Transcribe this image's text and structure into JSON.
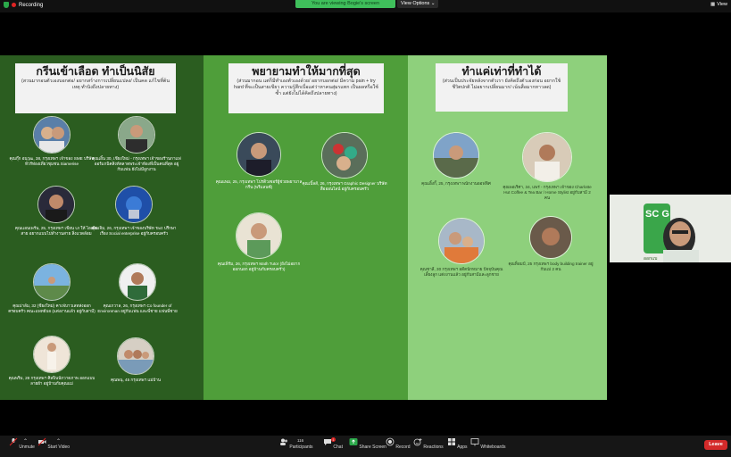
{
  "topbar": {
    "recording_label": "Recording",
    "viewing_banner": "You are viewing Bogie's screen",
    "view_options_label": "View Options",
    "view_label": "View"
  },
  "slide": {
    "columns": [
      {
        "title": "กรีนเข้าเลือด ทำเป็นนิสัย",
        "subtitle": "(สวนมากอนตัวเองบอกต่อ/ อยากสร้างการเปลี่ยนแปลง/ เป็นคด แก้ไขที่ต้นเหตุ ทำนิงถึงปลายทาง)",
        "people": [
          {
            "caption": "คุณกุ๊ก อนุวุฒ, 38, กรุงเทพฯ เจ้าของ SME บริษัท ทัวร์ท่องเที่ยวชุมชน Siamerise"
          },
          {
            "caption": "คุณเอิ้น 30, เชียงใหม่ - กรุงเทพฯ เจ้าของร้านกาแฟ ออร์แกนิคสิงห์ตลาดพระเจ้าห้องที่เป็นคนที่สุด อยู่กับแฟน ยังไม่มีลูกงาน"
          },
          {
            "caption": "คุณแอนเพร์น, 25, กรุงเทพฯ เขียน UI ให้ ไอเดียสาย อยากแบบไปทำงานสาย สิ่งแวดล้อม"
          },
          {
            "caption": "คุณเจิม, 26, กรุงเทพฯ เจ้าของบริษัท Tact ปรึกษาเรื่อง Social enterprise อยู่กับครอบครัว"
          },
          {
            "caption": "คุณปาล์ม, 32 (ชียงใหม่) คาเฟ่บาวเลทส่งออกครอบครัว คณะแพทย์บอ (แต่งงานแล้ว อยู่กับสามี)"
          },
          {
            "caption": "คุณเกวาล, 26, กรุงเทพฯ Co founder of Environman อยู่กับแฟน และพี่ชาย แฟนพี่ชาย"
          },
          {
            "caption": "คุณพริม, 28 กรุงเทพฯ ศิลปินนักวาดภาพ ออกแบบลายผ้า อยู่บ้านกับคุณแม่"
          },
          {
            "caption": "คุณพนุ, 45 กรุงเทพฯ แม่บ้าน"
          }
        ]
      },
      {
        "title": "พยายามทำให้มากที่สุด",
        "subtitle": "(ส่วนมากอน แต่ก็มีทำเองตัวเองด้วย/ อยากบอกต่อ/ มีความ pain + try hard ที่จะเป็นสายเขียว ความรู้สึกเบื่อแต่ว่าหาคนสุ่มรแทก เป็นผลหรือใช้ซ้ำ แต่ยังไม่ได้คิดถึงปลายทาง)",
        "people": [
          {
            "caption": "คุณแพม, 25, กรุงเทพฯ โปรดิวเซอร์ผู้ช่วยพยาบาลกรีน (พรีแลนซ์)"
          },
          {
            "caption": "คุณเบิ้ลส์, 26, กรุงเทพฯ Graphic Designer บริษัทสื่อออนไลน์ อยู่กับครอบครัว"
          },
          {
            "caption": "คุณเพิร์ม, 26, กรุงเทพฯ Math Tutor (ยังไม่อยากออกนอก อยู่บ้านกับครอบครัว)"
          }
        ]
      },
      {
        "title": "ทำแค่เท่าที่ทำได้",
        "subtitle": "(ส่วนเป็นประจัยหลังจากตัวเรา ยังคิดถึงตัวเองก่อน อยากใช้ ชีวิตปกติ ไม่อยากเปลี่ยนมาก/ เน้นสื่อมากหาวลด)",
        "people": [
          {
            "caption": "คุณเอิ้งกี้, 25, กรุงเทพฯ พนักงานออฟฟิศ"
          },
          {
            "caption": "คุณพอเริศา, 34, แพร่ - กรุงเทพฯ เจ้าของ Charlotte Hut Coffee & Tea Bar / Home Stylist อยู่กับสามี 2 คน"
          },
          {
            "caption": "คุณชาลี, 30 กรุงเทพฯ อดีตนักหมาย ปัจจุบันคุณเลี้ยงลูก แต่งงานแล้ว อยู่กับสามีและลูกชาย"
          },
          {
            "caption": "คุณท็อมป์, 25 กรุงเทพฯ body building trainer อยู่กับแม่ 2 คน"
          }
        ]
      }
    ]
  },
  "video_tile": {
    "logo_text": "SC G",
    "badge_text": "ออกแบ"
  },
  "toolbar": {
    "unmute": "Unmute",
    "start_video": "Start Video",
    "participants": "Participants",
    "participants_count": "116",
    "chat": "Chat",
    "chat_badge": "1",
    "share_screen": "Share Screen",
    "record": "Record",
    "reactions": "Reactions",
    "apps": "Apps",
    "whiteboards": "Whiteboards",
    "leave": "Leave"
  },
  "colors": {
    "col1": "#2b5d20",
    "col2": "#4f9e3a",
    "col3": "#8ed07c",
    "accent_green": "#3fbf5b",
    "leave_red": "#d42a2a"
  }
}
